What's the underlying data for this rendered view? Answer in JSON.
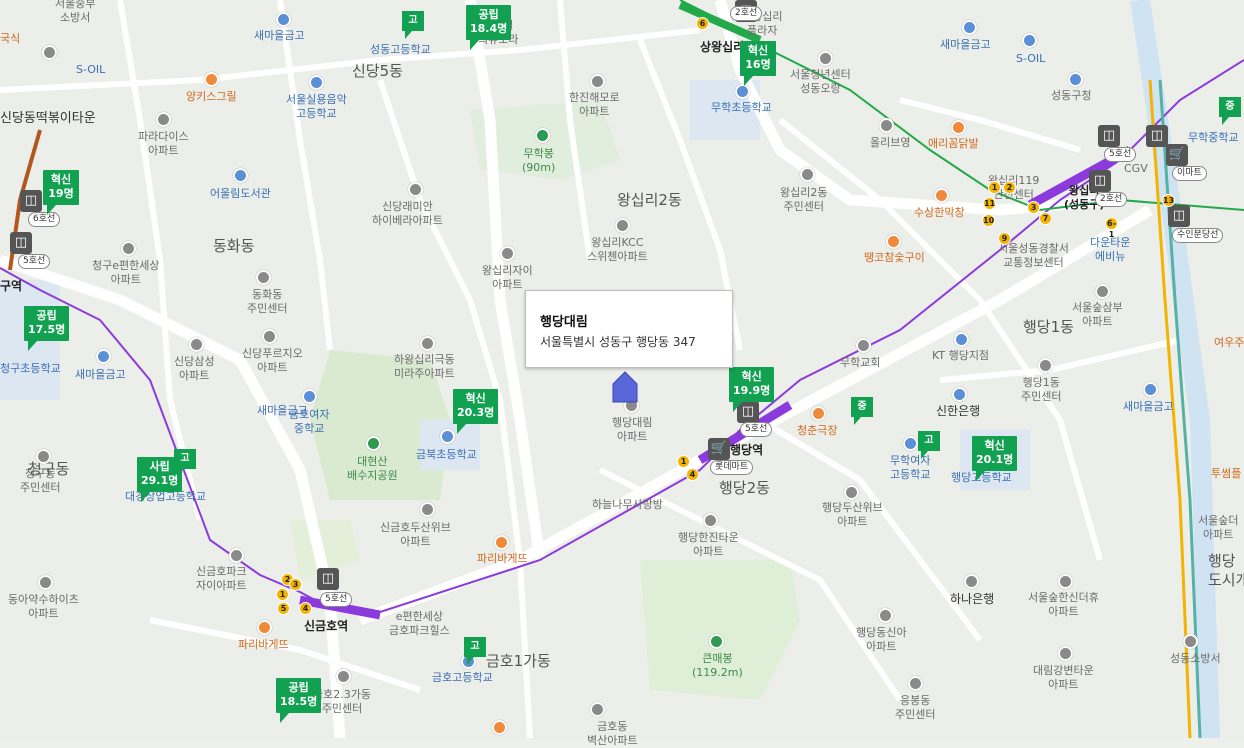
{
  "map": {
    "popup": {
      "title": "행당대림",
      "address": "서울특별시 성동구 행당동 347"
    },
    "areas": [
      {
        "id": "sindang5",
        "text": "신당5동"
      },
      {
        "id": "wangsimni2",
        "text": "왕십리2동"
      },
      {
        "id": "donghwa",
        "text": "동화동"
      },
      {
        "id": "haengdang1",
        "text": "행당1동"
      },
      {
        "id": "haengdang2",
        "text": "행당2동"
      },
      {
        "id": "geumho1",
        "text": "금호1가동"
      },
      {
        "id": "cheonggu",
        "text": "청구동"
      },
      {
        "id": "haengdangdosi",
        "text": "행당\n도시개발"
      }
    ],
    "stations": {
      "haengdang": "행당역",
      "singeumho": "신금호역",
      "sangwangsimni": "상왕십리",
      "wangsimni": "왕십리\n(성동구)",
      "cheonggu_partial": "구역"
    },
    "line_pills": {
      "l5": "5호선",
      "l6": "6호선",
      "l2": "2호선",
      "suinbundang": "수인분당선",
      "emart": "이마트",
      "lottemart": "롯데마트"
    },
    "schools": [
      {
        "name": "혁신",
        "value": "19명"
      },
      {
        "name": "공립",
        "value": "17.5명"
      },
      {
        "name": "사립",
        "value": "29.1명"
      },
      {
        "name": "공립",
        "value": "18.5명"
      },
      {
        "name": "혁신",
        "value": "20.3명"
      },
      {
        "name": "혁신",
        "value": "19.9명"
      },
      {
        "name": "혁신",
        "value": "20.1명"
      },
      {
        "name": "공립",
        "value": "18.4명"
      },
      {
        "name": "혁신",
        "value": "16명"
      }
    ],
    "mini_flags": {
      "go": "고",
      "jung": "중"
    },
    "labels": {
      "l_seouljung": "서울중부\n소방서",
      "l_gukshik": "국식",
      "l_soil1": "S-OIL",
      "l_saemaul1": "새마을금고",
      "l_sungdonggo": "성동고등학교",
      "l_rainhill": "라인힐\n의유보라",
      "l_yankees": "양키스그릴",
      "l_siljeong": "서울실용음악\n고등학교",
      "l_sindangtteok": "신당동떡볶이타운",
      "l_paradise": "파라다이스\n아파트",
      "l_eouleum": "어울림도서관",
      "l_sindang_hyoseong": "신당래미안\n하이베라아파트",
      "l_hanjin": "한진해모로\n아파트",
      "l_muhak_peak": "무학봉\n(90m)",
      "l_cheonggu_e": "청구e편한세상\n아파트",
      "l_donghwa_center": "동화동\n주민센터",
      "l_sindang_samsung": "신당삼성\n아파트",
      "l_sindang_puruji": "신당푸르지오\n아파트",
      "l_hayang": "하왕십리극동\n미라주아파트",
      "l_saemaul2": "새마을금고",
      "l_cheonggu_school": "청구초등학교",
      "l_geumho_girls": "금호여자\n중학교",
      "l_geumbuk": "금북초등학교",
      "l_baesuji": "대현산\n배수지공원",
      "l_cheonggu_center": "청구동\n주민센터",
      "l_daegyeong": "대경상업고등학교",
      "l_wangsimni_kcc": "왕십리KCC\n스위첸아파트",
      "l_wangsimni_zai": "왕십리자이\n아파트",
      "l_haengdang_daerim": "행당대림\n아파트",
      "l_haneul": "하늘나무사랑방",
      "l_haengdang_hanjin": "행당한진타운\n아파트",
      "l_paris1": "파리바게뜨",
      "l_singeumho_doosan": "신금호두산위브\n아파트",
      "l_singeumho_park": "신금호파크\n자이아파트",
      "l_donga": "동아약수하이츠\n아파트",
      "l_ehyun": "e편한세상\n금호파크힐스",
      "l_paris2": "파리바게뜨",
      "l_geumho_high": "금호고등학교",
      "l_geumho23": "금호2.3가동\n주민센터",
      "l_kunmae": "큰매봉\n(119.2m)",
      "l_geumho_el": "금호동\n벽산아파트",
      "l_muhak_church": "무학교회",
      "l_kt": "KT 행당지점",
      "l_sinhan": "신한은행",
      "l_chungchun": "청춘극장",
      "l_muhak_girls": "무학여자\n고등학교",
      "l_haengdang_doosan": "행당두산위브\n아파트",
      "l_hana": "하나은행",
      "l_haengdang_sinaa": "행당동신아\n아파트",
      "l_eungbong": "응봉동\n주민센터",
      "l_hd_high": "행당고등학교",
      "l_seoul_forest": "서울숲한신더휴\n아파트",
      "l_daerim_gang": "대림강변타운\n아파트",
      "l_ssh": "서울숲삼부\n아파트",
      "l_hd1_center": "행당1동\n주민센터",
      "l_saemaul3": "새마을금고",
      "l_police": "서울성동경찰서\n교통정보센터",
      "l_ddaeng": "땡코참숯구이",
      "l_susang": "수상한막창",
      "l_ari": "애리꼼닭발",
      "l_olive": "올리브영",
      "l_w2_center": "왕십리2동\n주민센터",
      "l_center119": "왕십리119\n안전센터",
      "l_youth": "서울청년센터\n성동오랑",
      "l_saemaul4": "새마을금고",
      "l_soil2": "S-OIL",
      "l_muhak_el": "무학초등학교",
      "l_seongdong_gu": "성동구청",
      "l_muhak_mid": "무학중학교",
      "l_cgv": "CGV",
      "l_daon": "다운타운\n에비뉴",
      "l_sd_fire": "성동소방서",
      "l_seoul_forest2": "서울숲더\n아파트",
      "l_tteusseom": "투썸플",
      "l_yeou": "여우주",
      "l_saemaul5": "새마을금고",
      "l_sowang_e": "상왕십리\n플라자"
    },
    "colors": {
      "line5": "#8b3bdd",
      "line2": "#22a94a",
      "line6": "#b2581f",
      "bundang": "#f2b400",
      "gyeongui": "#55b2a5",
      "flag": "#12a150"
    }
  }
}
